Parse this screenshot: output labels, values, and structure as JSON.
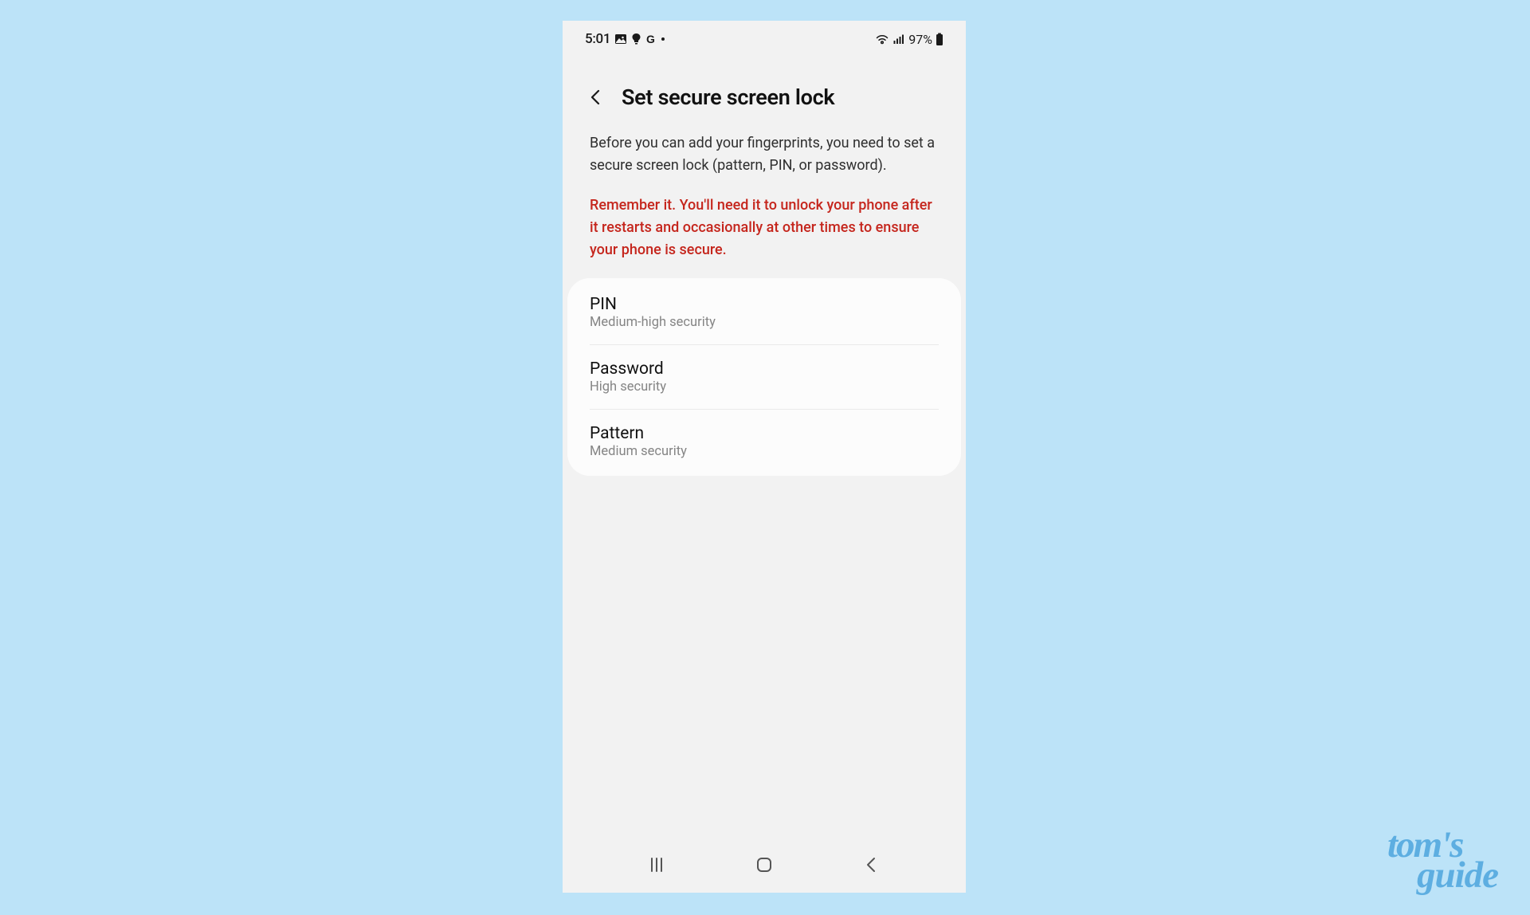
{
  "status_bar": {
    "time": "5:01",
    "battery": "97%"
  },
  "header": {
    "title": "Set secure screen lock"
  },
  "description": "Before you can add your fingerprints, you need to set a secure screen lock (pattern, PIN, or password).",
  "warning": "Remember it. You'll need it to unlock your phone after it restarts and occasionally at other times to ensure your phone is secure.",
  "options": [
    {
      "title": "PIN",
      "subtitle": "Medium-high security"
    },
    {
      "title": "Password",
      "subtitle": "High security"
    },
    {
      "title": "Pattern",
      "subtitle": "Medium security"
    }
  ],
  "watermark": {
    "line1": "tom's",
    "line2": "guide"
  }
}
